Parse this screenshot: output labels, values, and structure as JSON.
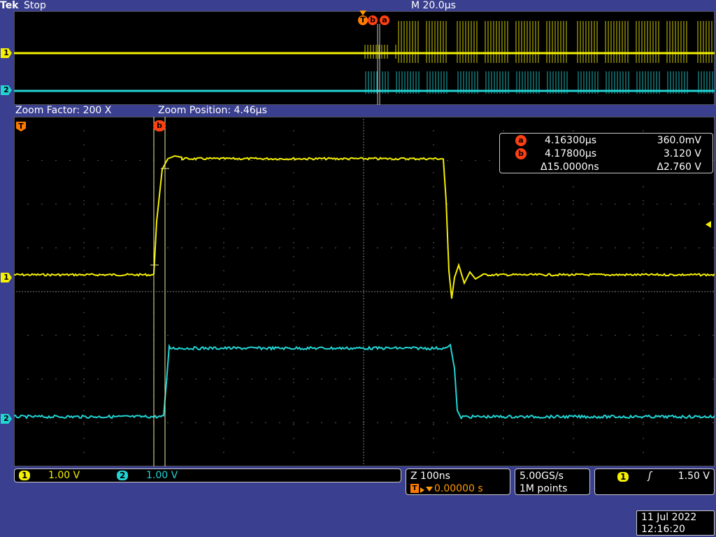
{
  "header": {
    "brand": "Tek",
    "run_state": "Stop",
    "timebase": "M 20.0μs"
  },
  "overview": {
    "trigger_marker": "T",
    "cursor_b": "b",
    "cursor_a": "a",
    "ch1_marker": "1",
    "ch2_marker": "2"
  },
  "zoom": {
    "factor": "Zoom Factor: 200 X",
    "position": "Zoom Position: 4.46μs"
  },
  "main": {
    "trigger_marker": "T",
    "cursor_b_tag": "b",
    "ch1_marker": "1",
    "ch2_marker": "2"
  },
  "readout": {
    "rows": [
      {
        "tag": "a",
        "time": "4.16300μs",
        "value": "360.0mV"
      },
      {
        "tag": "b",
        "time": "4.17800μs",
        "value": "3.120 V"
      },
      {
        "tag": "",
        "time": "Δ15.0000ns",
        "value": "Δ2.760 V"
      }
    ]
  },
  "channels": [
    {
      "id": "1",
      "scale": "1.00 V",
      "color": "#f5f000"
    },
    {
      "id": "2",
      "scale": "1.00 V",
      "color": "#22d4d4"
    }
  ],
  "zoom_scale": {
    "label": "Z 100ns",
    "trigger_delay": "0.00000 s",
    "trigger_glyph": "T"
  },
  "acquisition": {
    "rate": "5.00GS/s",
    "points": "1M points"
  },
  "trigger": {
    "channel": "1",
    "slope_glyph": "ʃ",
    "level": "1.50 V"
  },
  "datetime": {
    "date": "11 Jul  2022",
    "time": "12:16:20"
  },
  "colors": {
    "ch1": "#f5f000",
    "ch2": "#22d4d4",
    "background": "#3a3f8f",
    "cursor_tag": "#ff4010"
  }
}
